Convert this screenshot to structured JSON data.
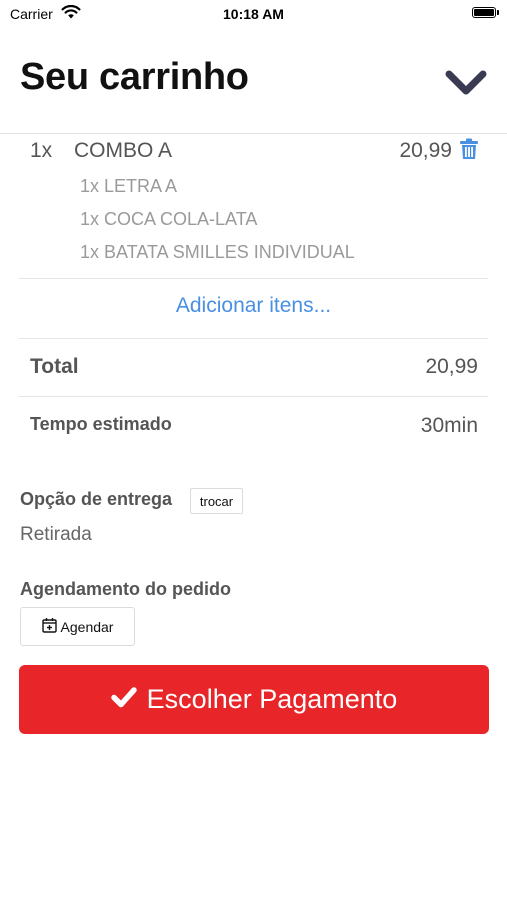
{
  "status_bar": {
    "carrier": "Carrier",
    "time": "10:18 AM",
    "icons": [
      "wifi-icon",
      "battery-icon"
    ]
  },
  "header": {
    "title": "Seu carrinho",
    "collapse_icon": "chevron-down-icon"
  },
  "cart": {
    "items": [
      {
        "qty": "1x",
        "name": "COMBO A",
        "price": "20,99",
        "remove_icon": "trash-icon",
        "components": [
          "1x LETRA A",
          "1x COCA COLA-LATA",
          "1x BATATA SMILLES INDIVIDUAL"
        ]
      }
    ],
    "add_items_label": "Adicionar itens..."
  },
  "summary": {
    "total_label": "Total",
    "total_value": "20,99",
    "time_label": "Tempo estimado",
    "time_value": "30min"
  },
  "delivery": {
    "label": "Opção de entrega",
    "change_button": "trocar",
    "value": "Retirada"
  },
  "schedule": {
    "label": "Agendamento do pedido",
    "button_label": "Agendar",
    "button_icon": "calendar-plus-icon"
  },
  "checkout": {
    "label": "Escolher Pagamento",
    "icon": "check-icon"
  },
  "colors": {
    "accent_blue": "#4a90e2",
    "primary_red": "#e8262a",
    "text": "#555555",
    "muted": "#9a9a9a"
  }
}
